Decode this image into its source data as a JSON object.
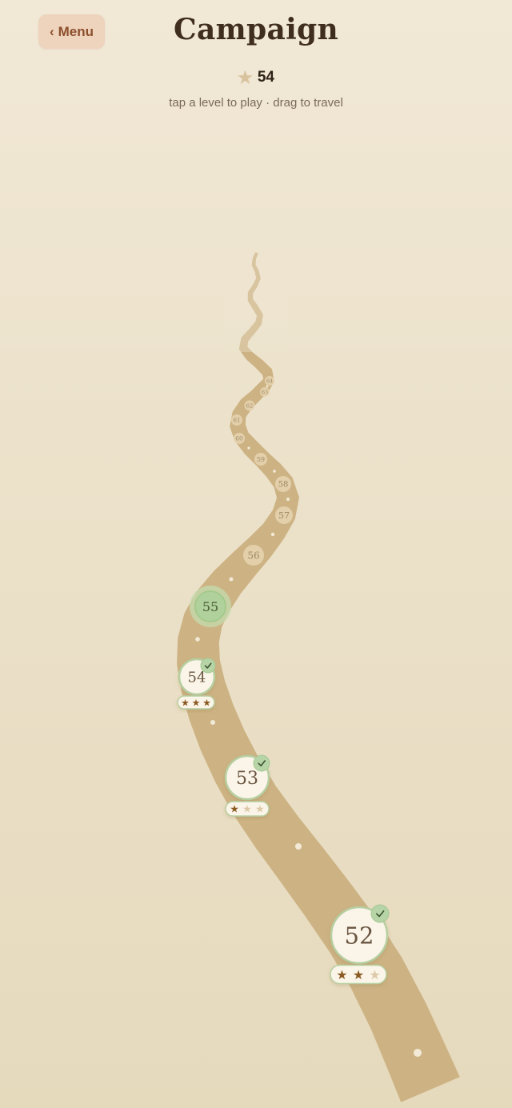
{
  "header": {
    "menu_label": "Menu",
    "title": "Campaign",
    "star_total": "54",
    "subtitle": "tap a level to play · drag to travel"
  },
  "colors": {
    "path": "#cdb384",
    "completed_fill": "#faf5e8",
    "completed_border": "#b6cea0",
    "check_badge": "#b6d4a6",
    "current_fill": "#b0d19b",
    "star_filled": "#8b5a22",
    "star_empty": "#dcc9a8",
    "locked_fill": "#e5d2ae",
    "locked_text": "#9e8a66"
  },
  "levels": [
    {
      "number": "52",
      "state": "completed",
      "stars": 2
    },
    {
      "number": "53",
      "state": "completed",
      "stars": 1
    },
    {
      "number": "54",
      "state": "completed",
      "stars": 3
    },
    {
      "number": "55",
      "state": "current"
    },
    {
      "number": "56",
      "state": "locked"
    },
    {
      "number": "57",
      "state": "locked"
    },
    {
      "number": "58",
      "state": "locked"
    },
    {
      "number": "59",
      "state": "locked"
    },
    {
      "number": "60",
      "state": "locked"
    },
    {
      "number": "61",
      "state": "locked"
    },
    {
      "number": "62",
      "state": "locked"
    },
    {
      "number": "63",
      "state": "locked"
    },
    {
      "number": "64",
      "state": "locked"
    }
  ]
}
